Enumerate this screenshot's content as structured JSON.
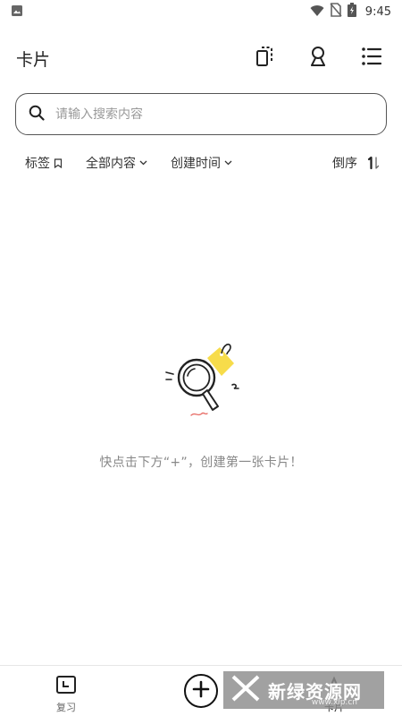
{
  "status_bar": {
    "time": "9:45"
  },
  "app_bar": {
    "title": "卡片"
  },
  "search": {
    "placeholder": "请输入搜索内容",
    "value": ""
  },
  "filters": {
    "tag_label": "标签",
    "content_label": "全部内容",
    "time_label": "创建时间",
    "sort_label": "倒序"
  },
  "empty_state": {
    "message": "快点击下方“+”，创建第一张卡片！"
  },
  "bottom_nav": {
    "review_label": "复习",
    "cards_label": "卡片"
  },
  "watermark": {
    "text": "新绿资源网",
    "sub": "www.xlp.cn"
  },
  "colors": {
    "accent_yellow": "#f7dc4a",
    "squiggle_red": "#e8706a"
  }
}
